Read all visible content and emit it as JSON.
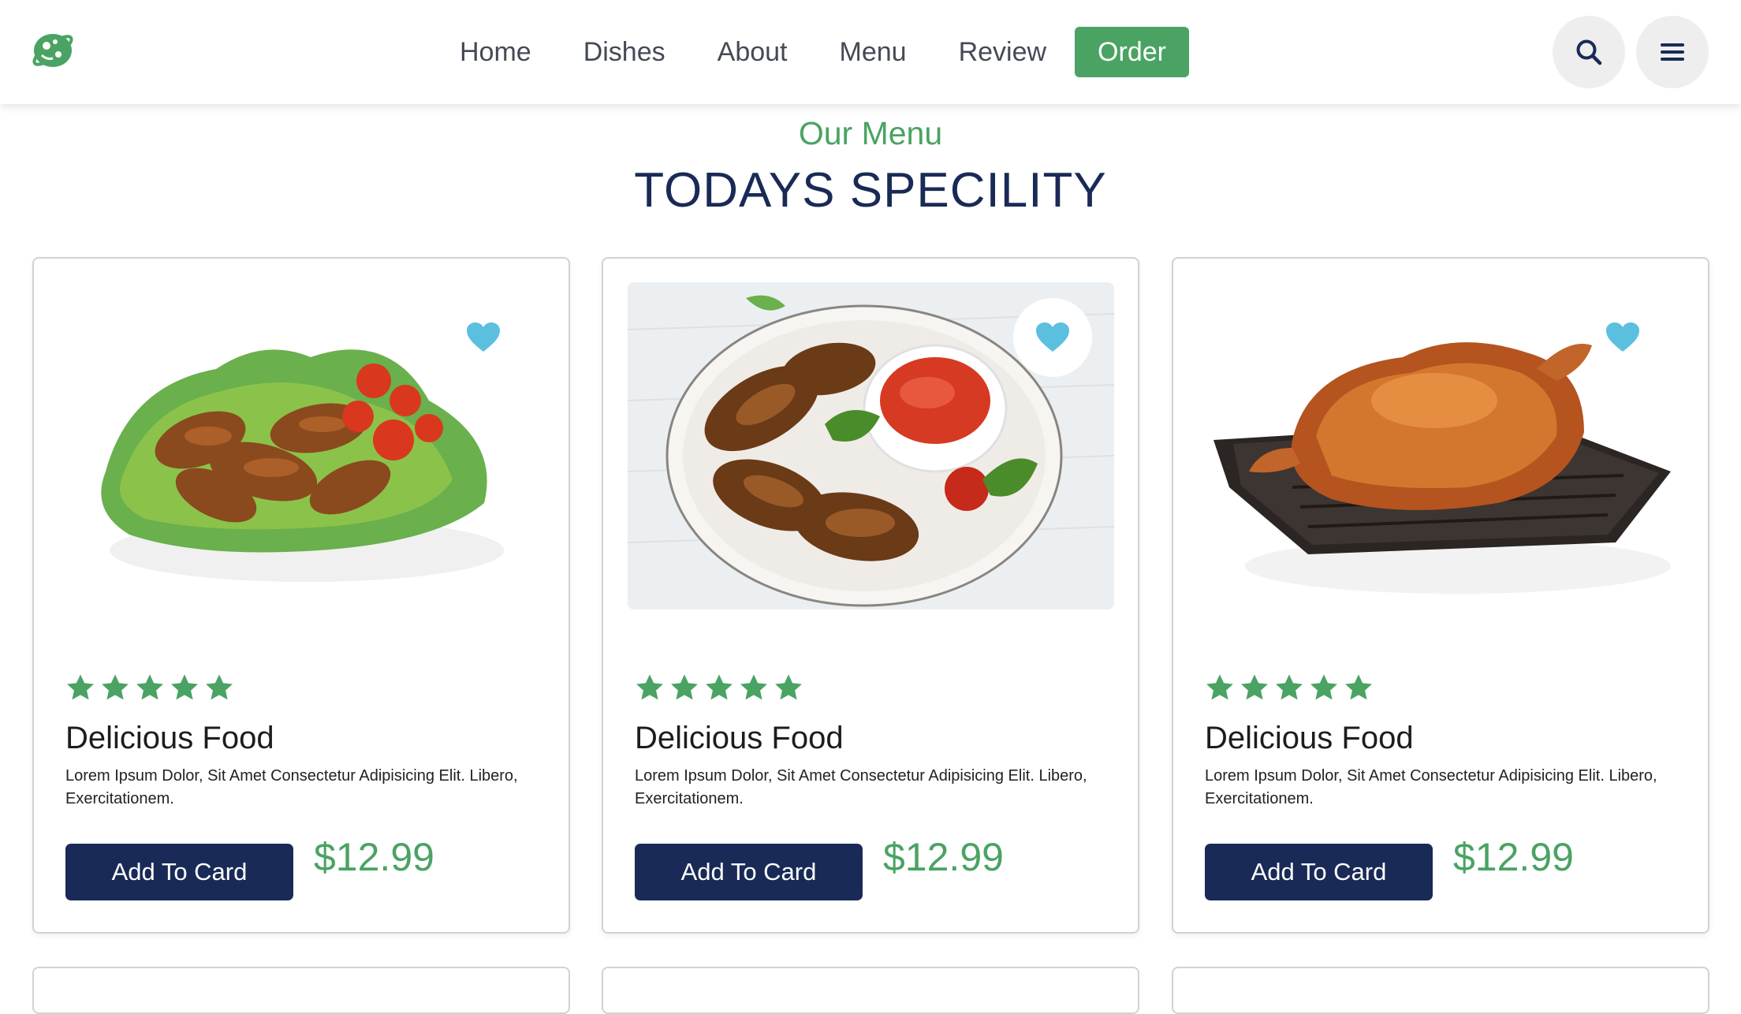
{
  "header": {
    "nav": [
      "Home",
      "Dishes",
      "About",
      "Menu",
      "Review",
      "Order"
    ],
    "active_nav": "Order"
  },
  "section": {
    "subtitle": "Our Menu",
    "title": "TODAYS SPECILITY"
  },
  "colors": {
    "accent_green": "#4aa363",
    "navy": "#192a56",
    "heart_blue": "#5bc0e0"
  },
  "icons": [
    "logo-icon",
    "search-icon",
    "hamburger-menu-icon",
    "heart-icon",
    "star-icon"
  ],
  "cards": [
    {
      "image": "grilled-chicken-wings-with-salad",
      "rating": 5,
      "title": "Delicious Food",
      "description": "Lorem Ipsum Dolor, Sit Amet Consectetur Adipisicing Elit. Libero, Exercitationem.",
      "button": "Add To Card",
      "price": "$12.99"
    },
    {
      "image": "chicken-wings-with-dipping-sauce",
      "rating": 5,
      "title": "Delicious Food",
      "description": "Lorem Ipsum Dolor, Sit Amet Consectetur Adipisicing Elit. Libero, Exercitationem.",
      "button": "Add To Card",
      "price": "$12.99"
    },
    {
      "image": "roast-chicken-on-tray",
      "rating": 5,
      "title": "Delicious Food",
      "description": "Lorem Ipsum Dolor, Sit Amet Consectetur Adipisicing Elit. Libero, Exercitationem.",
      "button": "Add To Card",
      "price": "$12.99"
    }
  ]
}
